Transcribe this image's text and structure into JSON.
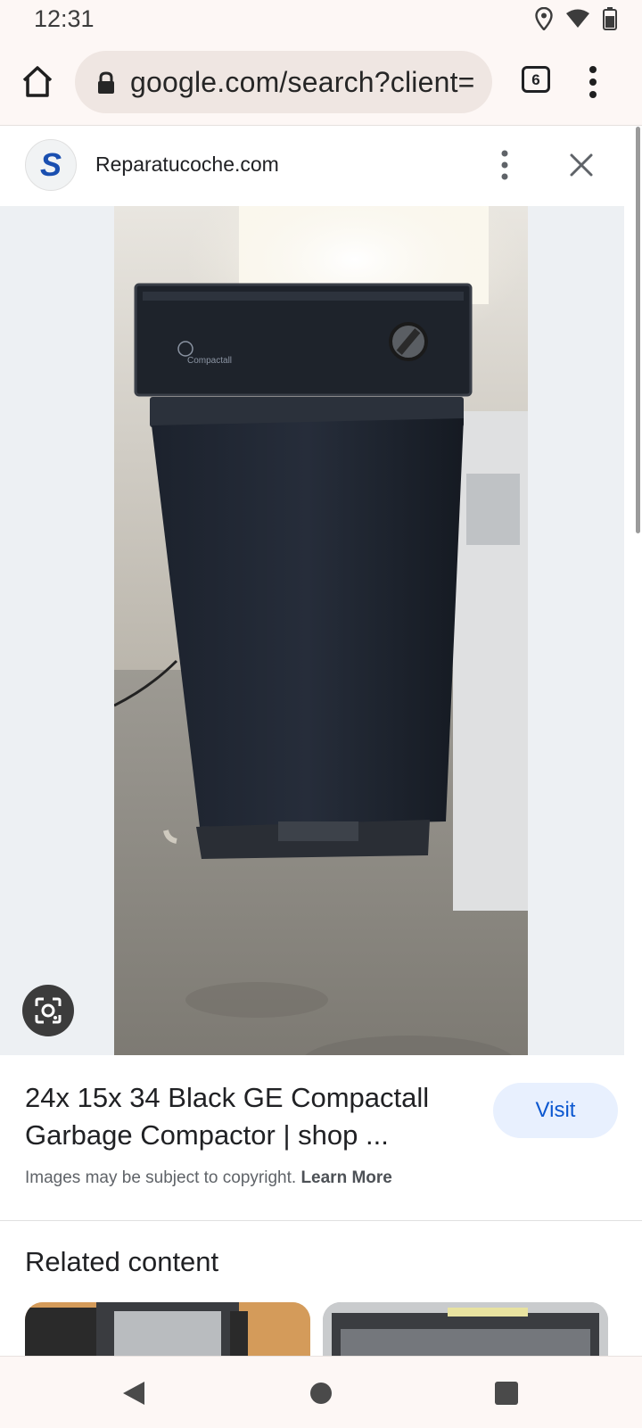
{
  "status_bar": {
    "time": "12:31",
    "icons": [
      "location-icon",
      "wifi-icon",
      "battery-icon"
    ]
  },
  "browser": {
    "url": "google.com/search?client=",
    "tab_count": "6"
  },
  "viewer": {
    "site_name": "Reparatucoche.com",
    "site_logo_letter": "S"
  },
  "result": {
    "title": "24x 15x 34 Black GE Compactall Garbage Compactor | shop ...",
    "visit_label": "Visit",
    "copyright_text": "Images may be subject to copyright.",
    "learn_more": "Learn More"
  },
  "related": {
    "heading": "Related content"
  },
  "colors": {
    "accent": "#0b57d0",
    "visit_bg": "#e8f0fe",
    "chrome_bg": "#fdf7f5"
  }
}
